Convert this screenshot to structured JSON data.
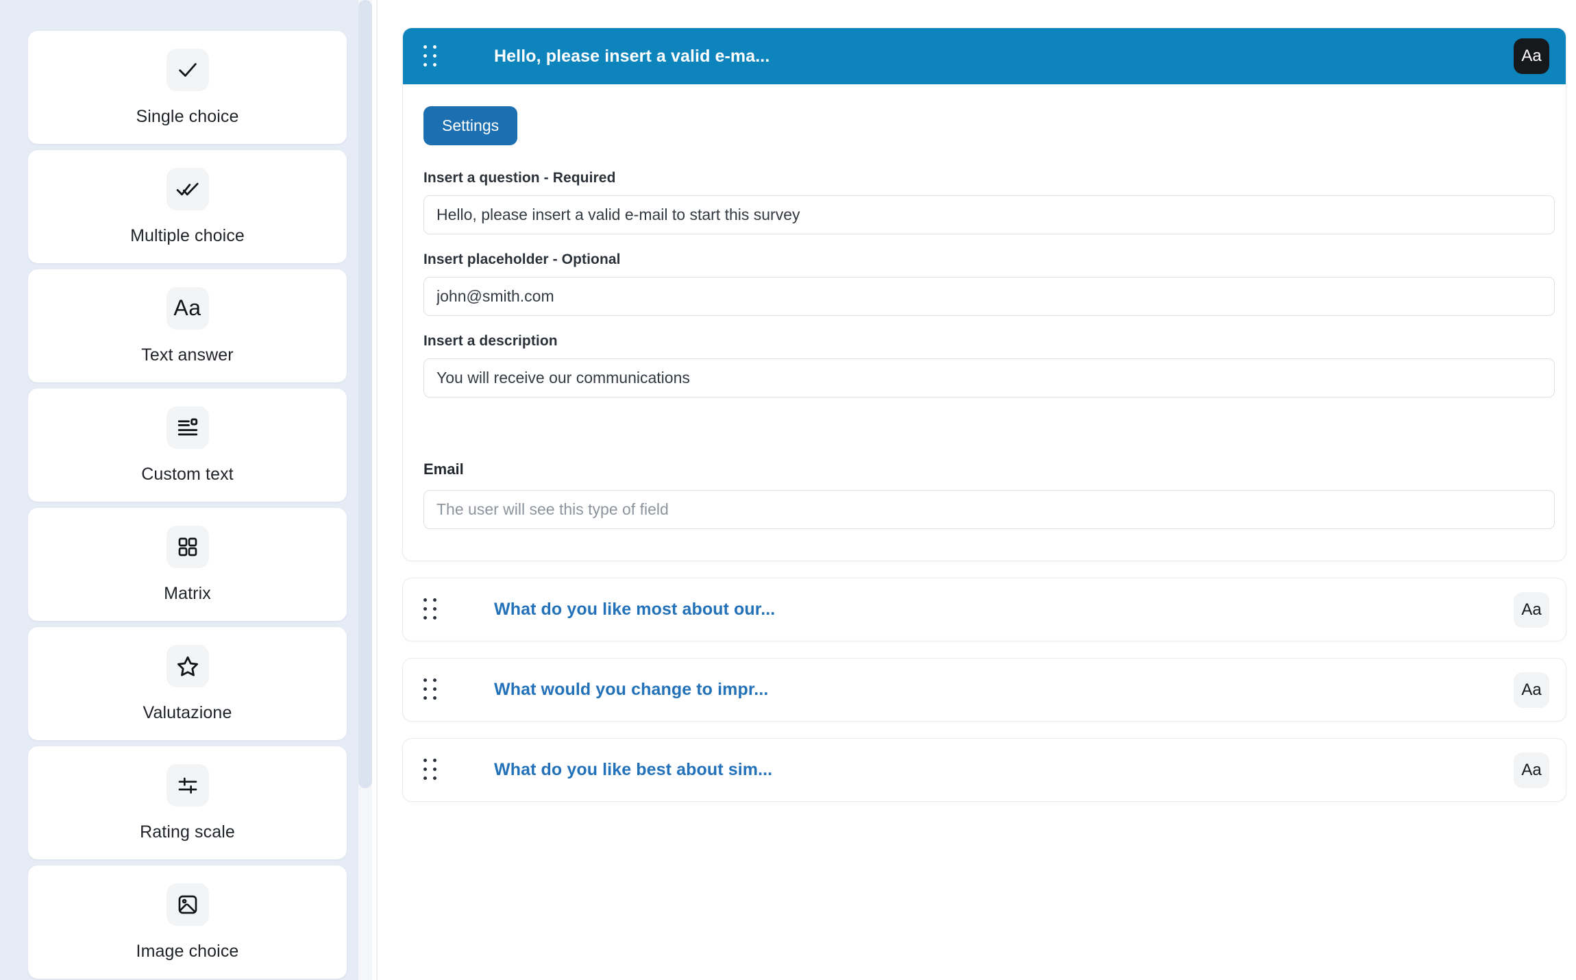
{
  "sidebar": {
    "items": [
      {
        "label": "Single choice",
        "icon": "check-icon"
      },
      {
        "label": "Multiple choice",
        "icon": "double-check-icon"
      },
      {
        "label": "Text answer",
        "icon": "text-aa-icon"
      },
      {
        "label": "Custom text",
        "icon": "custom-text-icon"
      },
      {
        "label": "Matrix",
        "icon": "grid-squares-icon"
      },
      {
        "label": "Valutazione",
        "icon": "star-icon"
      },
      {
        "label": "Rating scale",
        "icon": "sliders-icon"
      },
      {
        "label": "Image choice",
        "icon": "image-icon"
      }
    ]
  },
  "colors": {
    "header_blue": "#0e84bd",
    "settings_blue": "#1c6fb0",
    "link_blue": "#2371b8",
    "sidebar_bg": "#e6ecf6",
    "aa_dark": "#16181b"
  },
  "editor": {
    "header": {
      "title": "Hello, please insert a valid e-ma...",
      "drag_handle": "drag-handle-icon",
      "aa_button": "Aa"
    },
    "settings_button": "Settings",
    "fields": [
      {
        "label": "Insert a question - Required",
        "value": "Hello, please insert a valid e-mail to start this survey",
        "placeholder": ""
      },
      {
        "label": "Insert placeholder - Optional",
        "value": "john@smith.com",
        "placeholder": ""
      },
      {
        "label": "Insert a description",
        "value": "You will receive our communications",
        "placeholder": ""
      }
    ],
    "preview": {
      "label": "Email",
      "value": "",
      "placeholder": "The user will see this type of field"
    }
  },
  "collapsed_questions": [
    {
      "title": "What do you like most about our...",
      "aa_button": "Aa"
    },
    {
      "title": "What would you change to impr...",
      "aa_button": "Aa"
    },
    {
      "title": "What do you like best about sim...",
      "aa_button": "Aa"
    }
  ]
}
